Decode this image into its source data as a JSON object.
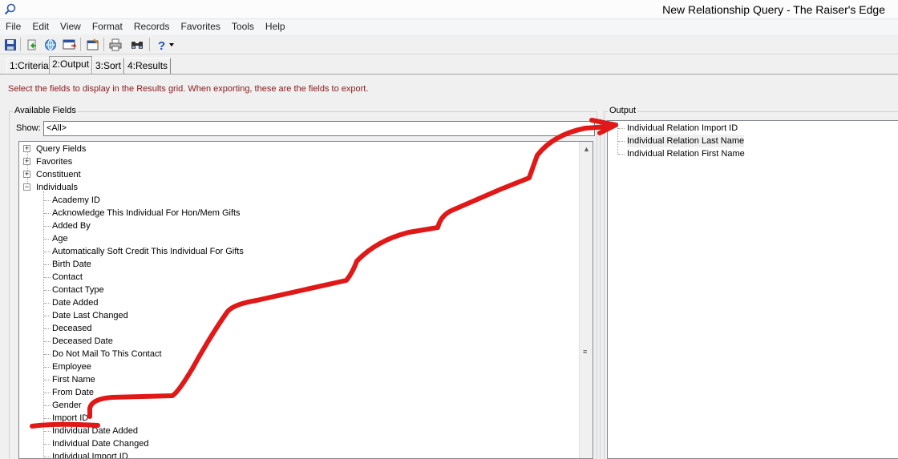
{
  "window": {
    "title": "New Relationship Query - The Raiser's Edge"
  },
  "menu": [
    "File",
    "Edit",
    "View",
    "Format",
    "Records",
    "Favorites",
    "Tools",
    "Help"
  ],
  "toolbar_icons": [
    "save-icon",
    "export-icon",
    "globe-icon",
    "run-icon",
    "properties-icon",
    "print-icon",
    "find-icon",
    "help-icon",
    "dropdown-arrow-icon"
  ],
  "tabs": [
    {
      "label": "1:Criteria"
    },
    {
      "label": "2:Output"
    },
    {
      "label": "3:Sort"
    },
    {
      "label": "4:Results"
    }
  ],
  "instruction": "Select the fields to display in the Results grid.  When exporting, these are the fields to export.",
  "available": {
    "title": "Available Fields",
    "show_label": "Show:",
    "show_value": "<All>",
    "top_nodes": [
      "Query Fields",
      "Favorites",
      "Constituent",
      "Individuals"
    ],
    "individual_fields": [
      "Academy ID",
      "Acknowledge This Individual For Hon/Mem Gifts",
      "Added By",
      "Age",
      "Automatically Soft Credit This Individual For Gifts",
      "Birth Date",
      "Contact",
      "Contact Type",
      "Date Added",
      "Date Last Changed",
      "Deceased",
      "Deceased Date",
      "Do Not Mail To This Contact",
      "Employee",
      "First Name",
      "From Date",
      "Gender",
      "Import ID",
      "Individual Date Added",
      "Individual Date Changed",
      "Individual Import ID"
    ]
  },
  "output": {
    "title": "Output",
    "fields": [
      "Individual Relation Import ID",
      "Individual Relation Last Name",
      "Individual Relation First Name"
    ]
  },
  "colors": {
    "instruction_text": "#8b1a1a",
    "annotation": "#e01818"
  }
}
